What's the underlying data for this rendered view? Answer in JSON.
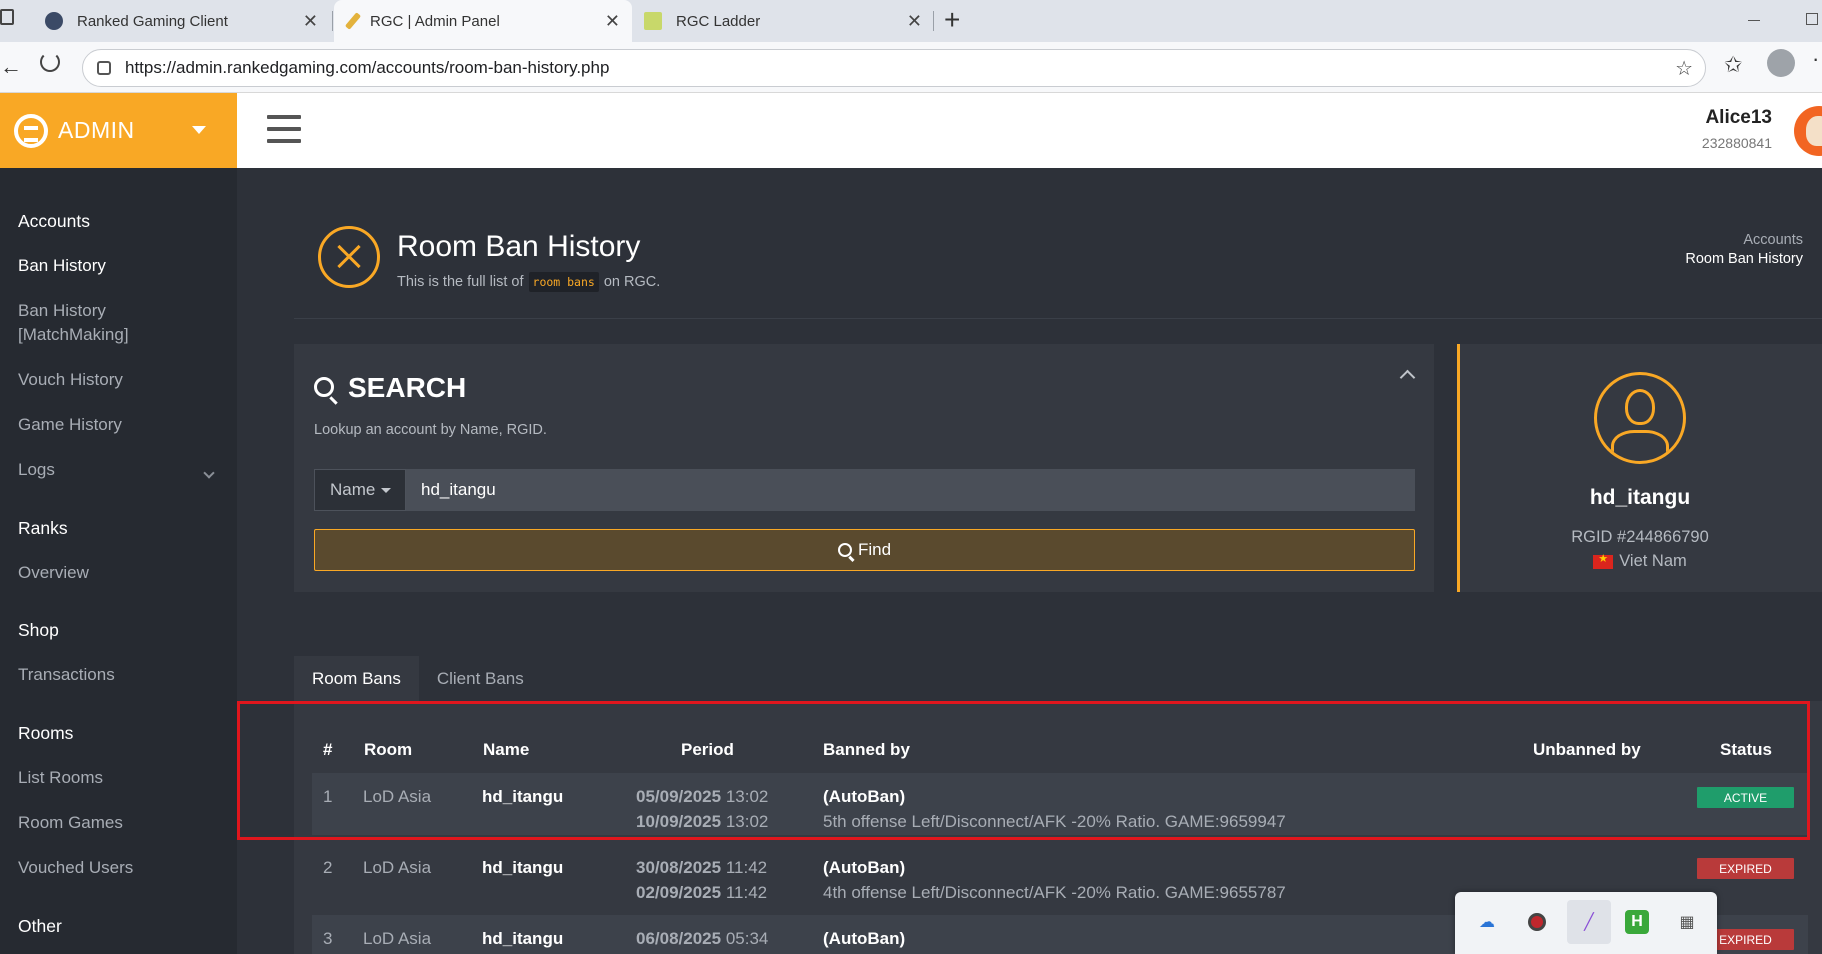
{
  "browser": {
    "tabs": [
      {
        "title": "Ranked Gaming Client"
      },
      {
        "title": "RGC | Admin Panel"
      },
      {
        "title": "RGC Ladder"
      }
    ],
    "close_glyph": "✕",
    "new_tab_glyph": "+",
    "url": "https://admin.rankedgaming.com/accounts/room-ban-history.php"
  },
  "brand": {
    "label": "ADMIN",
    "color": "#f9a825"
  },
  "user": {
    "name": "Alice13",
    "id": "232880841"
  },
  "sidebar": {
    "items": [
      {
        "label": "Accounts",
        "head": true
      },
      {
        "label": "Ban History",
        "active": true
      },
      {
        "label": "Ban History"
      },
      {
        "label": "[MatchMaking]"
      },
      {
        "label": "Vouch History"
      },
      {
        "label": "Game History"
      },
      {
        "label": "Logs"
      },
      {
        "label": "Ranks",
        "head": true
      },
      {
        "label": "Overview"
      },
      {
        "label": "Shop",
        "head": true
      },
      {
        "label": "Transactions"
      },
      {
        "label": "Rooms",
        "head": true
      },
      {
        "label": "List Rooms"
      },
      {
        "label": "Room Games"
      },
      {
        "label": "Vouched Users"
      },
      {
        "label": "Other",
        "head": true
      }
    ]
  },
  "page": {
    "title": "Room Ban History",
    "subtitle_pre": "This is the full list of",
    "subtitle_code": "room bans",
    "subtitle_post": "on RGC.",
    "breadcrumb": [
      "Accounts",
      "Room Ban History"
    ]
  },
  "search": {
    "title": "SEARCH",
    "help": "Lookup an account by Name, RGID.",
    "field_type": "Name",
    "value": "hd_itangu",
    "button": "Find"
  },
  "profile": {
    "name": "hd_itangu",
    "rgid": "RGID #244866790",
    "country": "Viet Nam"
  },
  "tabs": [
    "Room Bans",
    "Client Bans"
  ],
  "table": {
    "headers": [
      "#",
      "Room",
      "Name",
      "Period",
      "Banned by",
      "Unbanned by",
      "Status"
    ],
    "rows": [
      {
        "num": "1",
        "room": "LoD Asia",
        "name": "hd_itangu",
        "from_date": "05/09/2025",
        "from_time": "13:02",
        "to_date": "10/09/2025",
        "to_time": "13:02",
        "banned_by": "(AutoBan)",
        "reason": "5th offense Left/Disconnect/AFK -20% Ratio. GAME:9659947",
        "unbanned_by": "",
        "status": "ACTIVE"
      },
      {
        "num": "2",
        "room": "LoD Asia",
        "name": "hd_itangu",
        "from_date": "30/08/2025",
        "from_time": "11:42",
        "to_date": "02/09/2025",
        "to_time": "11:42",
        "banned_by": "(AutoBan)",
        "reason": "4th offense Left/Disconnect/AFK -20% Ratio. GAME:9655787",
        "unbanned_by": "",
        "status": "EXPIRED"
      },
      {
        "num": "3",
        "room": "LoD Asia",
        "name": "hd_itangu",
        "from_date": "06/08/2025",
        "from_time": "05:34",
        "to_date": "",
        "to_time": "",
        "banned_by": "(AutoBan)",
        "reason": "",
        "unbanned_by": "",
        "status": "EXPIRED"
      }
    ]
  },
  "colors": {
    "accent": "#f9a825",
    "active": "#1f9d6b",
    "expired": "#b93a3a",
    "highlight": "#e0161d"
  },
  "tray_icons": [
    "cloud-icon",
    "record-icon",
    "feather-icon",
    "h-app-icon",
    "network-icon"
  ]
}
